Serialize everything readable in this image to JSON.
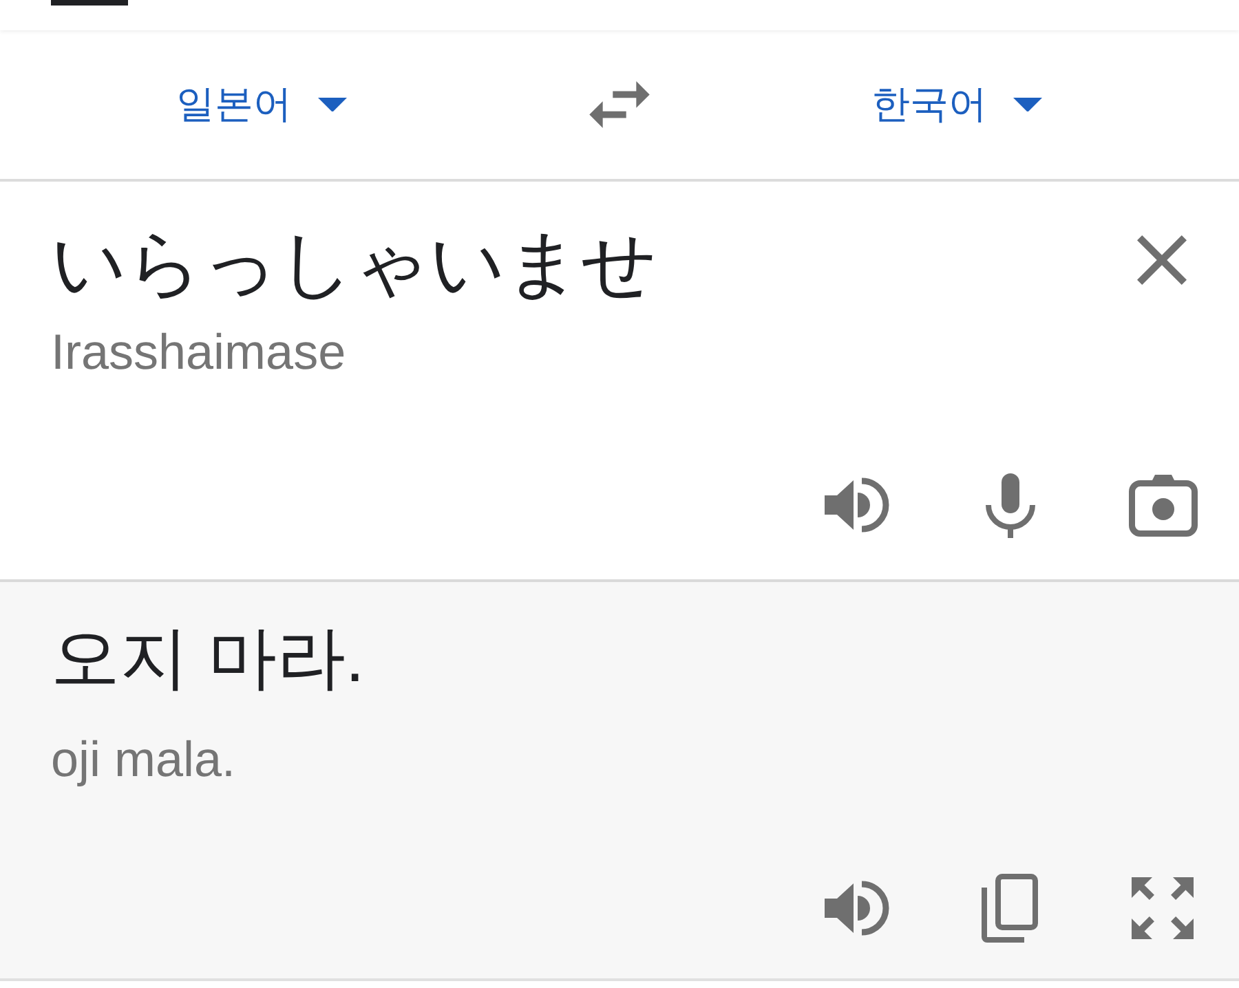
{
  "language_bar": {
    "source_language": "일본어",
    "target_language": "한국어"
  },
  "input": {
    "text": "いらっしゃいませ",
    "romanization": "Irasshaimase"
  },
  "output": {
    "text": "오지 마라.",
    "romanization": "oji mala."
  }
}
